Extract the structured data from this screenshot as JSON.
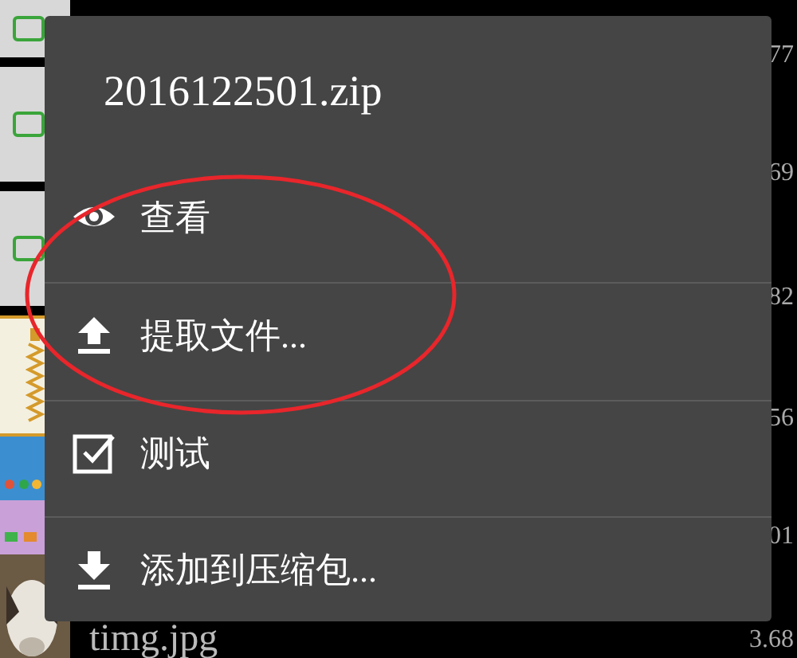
{
  "file_list": [
    {
      "kind": "video",
      "size": "77"
    },
    {
      "kind": "video",
      "size": "69"
    },
    {
      "kind": "video",
      "size": "82"
    },
    {
      "kind": "archive",
      "size": "56"
    },
    {
      "kind": "screenshot",
      "size": "01"
    },
    {
      "name": "timg.jpg",
      "size": "3.68"
    }
  ],
  "menu": {
    "title": "2016122501.zip",
    "items": [
      {
        "kind": "view",
        "label": "查看"
      },
      {
        "kind": "extract",
        "label": "提取文件..."
      },
      {
        "kind": "test",
        "label": "测试"
      },
      {
        "kind": "add",
        "label": "添加到压缩包..."
      }
    ]
  }
}
